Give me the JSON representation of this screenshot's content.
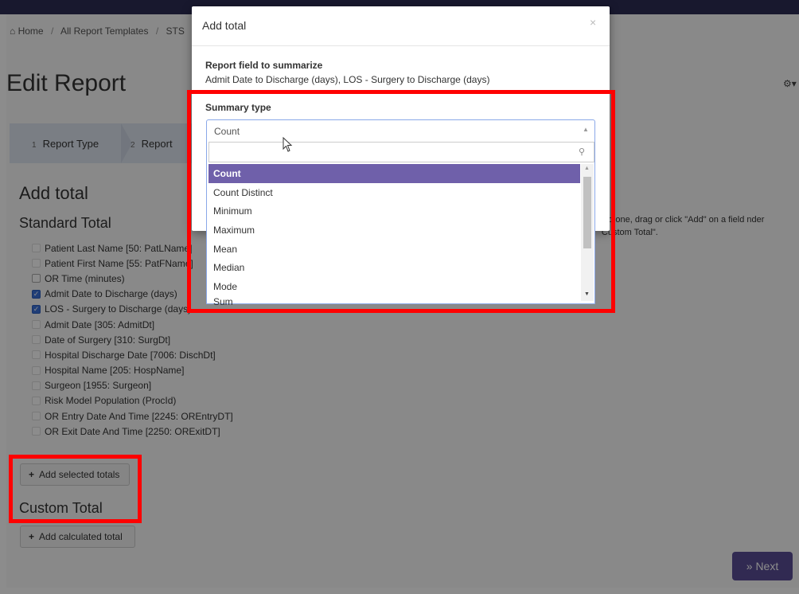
{
  "breadcrumb": [
    "Home",
    "All Report Templates",
    "STS"
  ],
  "page": {
    "title": "Edit Report",
    "gear": "⚙▾",
    "steps": [
      {
        "num": "1",
        "label": "Report Type"
      },
      {
        "num": "2",
        "label": "Report"
      }
    ],
    "add_total_heading": "Add total",
    "standard_total_heading": "Standard Total",
    "help_text": "add one, drag or click \"Add\" on a field          nder \"Custom Total\".",
    "fields": [
      {
        "label": "Patient Last Name [50: PatLName]",
        "checked": false
      },
      {
        "label": "Patient First Name [55: PatFName]",
        "checked": false
      },
      {
        "label": "OR Time (minutes)",
        "checked": false
      },
      {
        "label": "Admit Date to Discharge (days)",
        "checked": true
      },
      {
        "label": "LOS - Surgery to Discharge (days)",
        "checked": true
      },
      {
        "label": "Admit Date [305: AdmitDt]",
        "checked": false
      },
      {
        "label": "Date of Surgery [310: SurgDt]",
        "checked": false
      },
      {
        "label": "Hospital Discharge Date [7006: DischDt]",
        "checked": false
      },
      {
        "label": "Hospital Name [205: HospName]",
        "checked": false
      },
      {
        "label": "Surgeon [1955: Surgeon]",
        "checked": false
      },
      {
        "label": "Risk Model Population (ProcId)",
        "checked": false
      },
      {
        "label": "OR Entry Date And Time [2245: OREntryDT]",
        "checked": false
      },
      {
        "label": "OR Exit Date And Time [2250: ORExitDT]",
        "checked": false
      }
    ],
    "add_selected_label": "Add selected totals",
    "custom_total_heading": "Custom Total",
    "add_calculated_label": "Add calculated total",
    "next_label": "» Next"
  },
  "modal": {
    "title": "Add total",
    "close": "×",
    "field_label": "Report field to summarize",
    "field_value": "Admit Date to Discharge (days), LOS - Surgery to Discharge (days)",
    "summary_label": "Summary type",
    "select_value": "Count",
    "search_placeholder": "",
    "options": [
      "Count",
      "Count Distinct",
      "Minimum",
      "Maximum",
      "Mean",
      "Median",
      "Mode",
      "Sum"
    ],
    "selected_option": "Count"
  },
  "colors": {
    "highlight": "#ff0000",
    "selected_option": "#6f60aa",
    "next_button": "#5a4e96",
    "checkbox_checked": "#3b72d9"
  }
}
